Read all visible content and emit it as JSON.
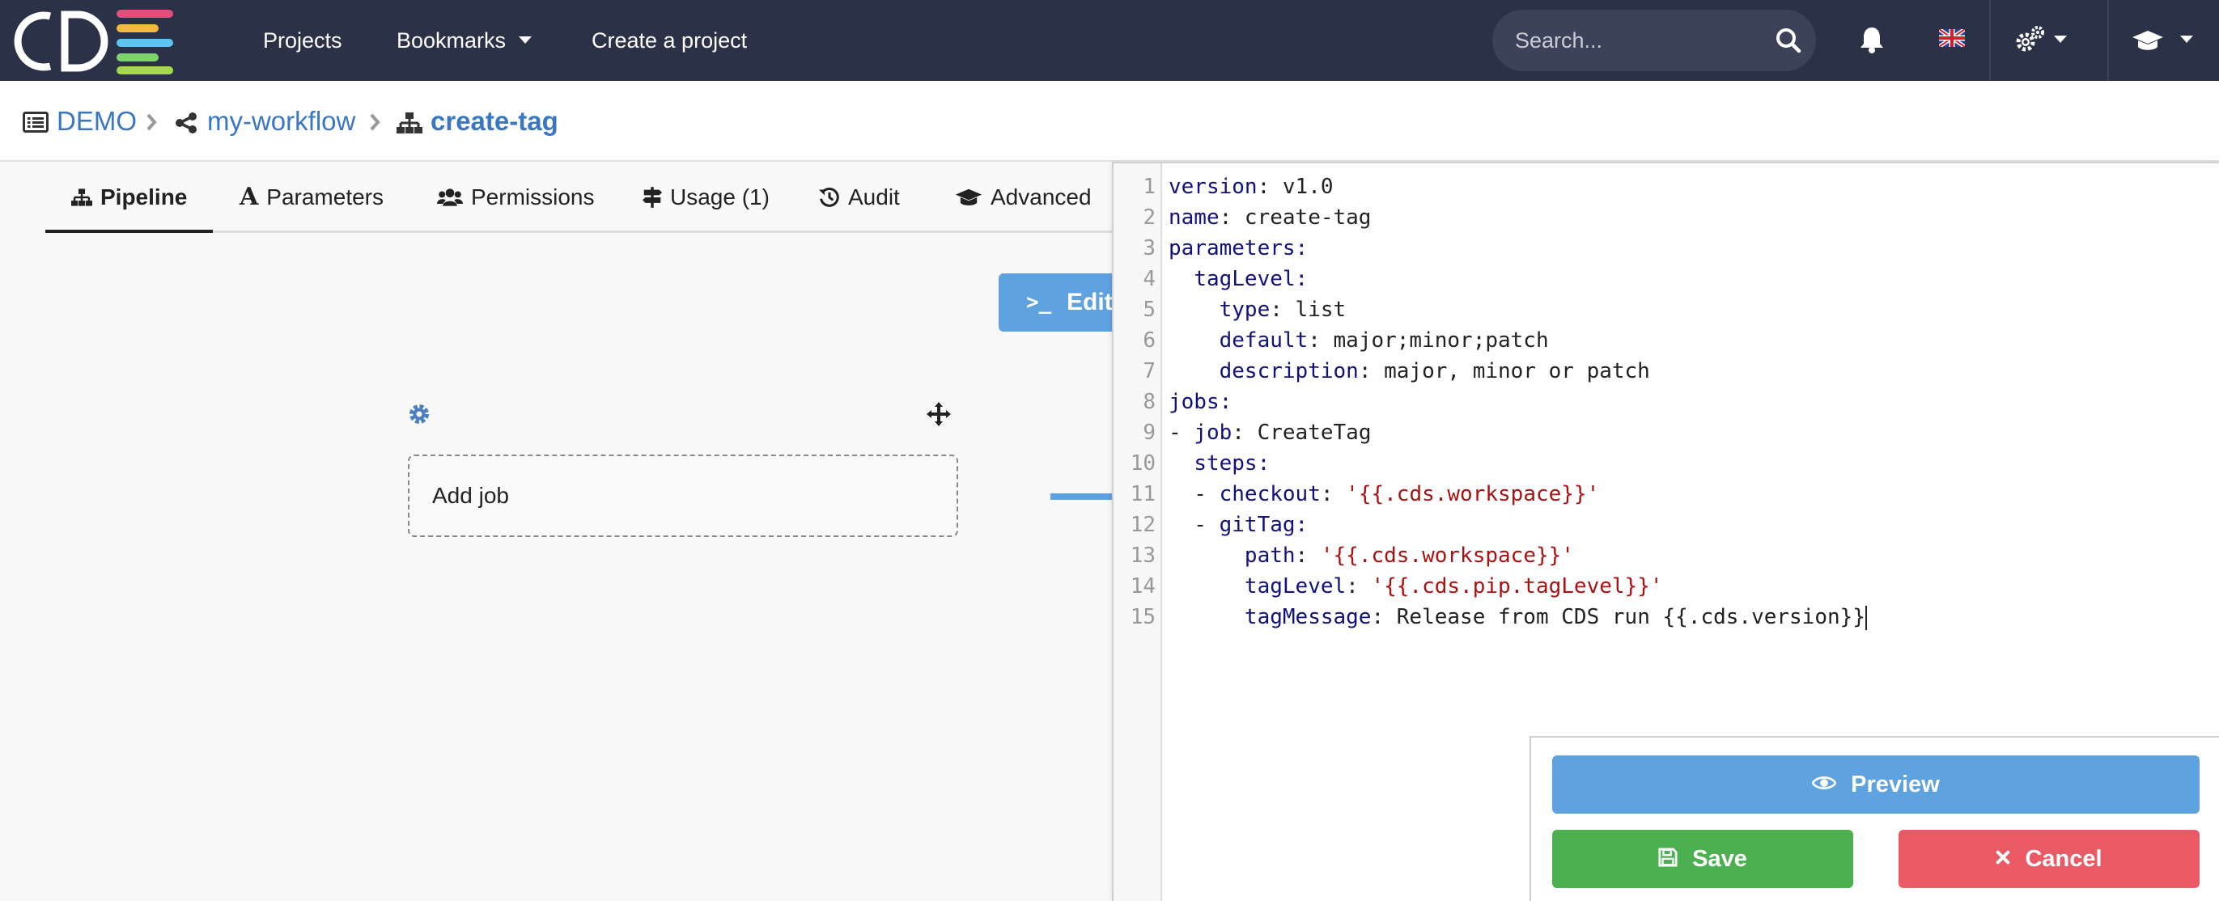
{
  "navbar": {
    "logo_text": "CDS",
    "links": [
      "Projects",
      "Bookmarks",
      "Create a project"
    ],
    "search": {
      "placeholder": "Search..."
    },
    "icons": [
      "bell-icon",
      "flag-uk-icon",
      "cogs-icon",
      "graduation-cap-icon"
    ]
  },
  "breadcrumb": {
    "project": "DEMO",
    "workflow": "my-workflow",
    "pipeline": "create-tag"
  },
  "tabs": [
    {
      "label": "Pipeline",
      "icon": "sitemap-icon",
      "active": true
    },
    {
      "label": "Parameters",
      "icon": "font-icon"
    },
    {
      "label": "Permissions",
      "icon": "users-icon"
    },
    {
      "label": "Usage (1)",
      "icon": "signs-icon"
    },
    {
      "label": "Audit",
      "icon": "history-icon"
    },
    {
      "label": "Advanced",
      "icon": "graduation-cap-icon"
    }
  ],
  "canvas": {
    "edit_button": {
      "prompt": ">_",
      "label": "Edit"
    },
    "add_job": "Add job"
  },
  "editor": {
    "lines": [
      [
        {
          "t": "version",
          "c": "key"
        },
        {
          "t": ": v1.0"
        }
      ],
      [
        {
          "t": "name",
          "c": "key"
        },
        {
          "t": ": create-tag"
        }
      ],
      [
        {
          "t": "parameters",
          "c": "key"
        },
        {
          "t": ":",
          "c": "key"
        }
      ],
      [
        {
          "t": "  "
        },
        {
          "t": "tagLevel",
          "c": "key"
        },
        {
          "t": ":",
          "c": "key"
        }
      ],
      [
        {
          "t": "    "
        },
        {
          "t": "type",
          "c": "key"
        },
        {
          "t": ": list"
        }
      ],
      [
        {
          "t": "    "
        },
        {
          "t": "default",
          "c": "key"
        },
        {
          "t": ": major;minor;patch"
        }
      ],
      [
        {
          "t": "    "
        },
        {
          "t": "description",
          "c": "key"
        },
        {
          "t": ": major, minor or patch"
        }
      ],
      [
        {
          "t": "jobs",
          "c": "key"
        },
        {
          "t": ":",
          "c": "key"
        }
      ],
      [
        {
          "t": "- "
        },
        {
          "t": "job",
          "c": "key"
        },
        {
          "t": ": CreateTag"
        }
      ],
      [
        {
          "t": "  "
        },
        {
          "t": "steps",
          "c": "key"
        },
        {
          "t": ":",
          "c": "key"
        }
      ],
      [
        {
          "t": "  - "
        },
        {
          "t": "checkout",
          "c": "key"
        },
        {
          "t": ": "
        },
        {
          "t": "'{{.cds.workspace}}'",
          "c": "str"
        }
      ],
      [
        {
          "t": "  - "
        },
        {
          "t": "gitTag",
          "c": "key"
        },
        {
          "t": ":",
          "c": "key"
        }
      ],
      [
        {
          "t": "      "
        },
        {
          "t": "path",
          "c": "key"
        },
        {
          "t": ": "
        },
        {
          "t": "'{{.cds.workspace}}'",
          "c": "str"
        }
      ],
      [
        {
          "t": "      "
        },
        {
          "t": "tagLevel",
          "c": "key"
        },
        {
          "t": ": "
        },
        {
          "t": "'{{.cds.pip.tagLevel}}'",
          "c": "str"
        }
      ],
      [
        {
          "t": "      "
        },
        {
          "t": "tagMessage",
          "c": "key"
        },
        {
          "t": ": Release from CDS run {{.cds.version}}"
        }
      ]
    ]
  },
  "actions": {
    "preview": "Preview",
    "save": "Save",
    "cancel": "Cancel"
  },
  "colors": {
    "navbar": "#2b3147",
    "link": "#3a77c2",
    "primary": "#5fa2e0",
    "success": "#4caf50",
    "danger": "#ea5a64"
  }
}
